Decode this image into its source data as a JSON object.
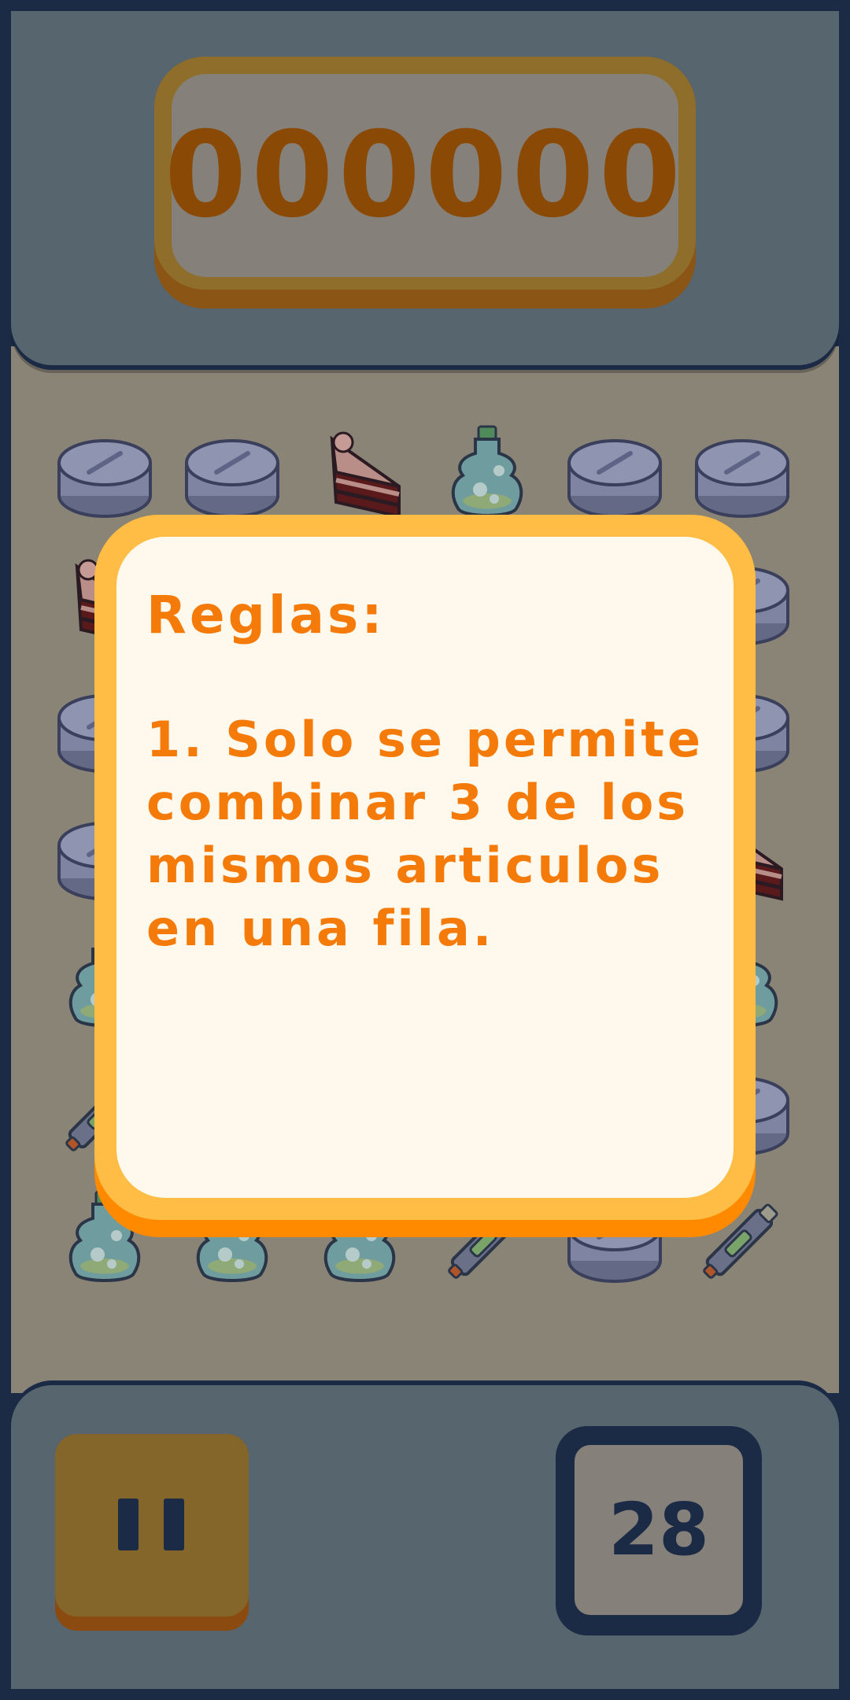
{
  "score": {
    "value": "000000"
  },
  "moves": {
    "value": "28"
  },
  "rules_modal": {
    "title": "Reglas:",
    "rule": "1. Solo se permite combinar 3 de los mismos articulos en una fila."
  },
  "board": {
    "rows": [
      [
        "tablet-icon",
        "tablet-icon",
        "cake-slice-icon",
        "potion-bottle-icon",
        "tablet-icon",
        "tablet-icon"
      ],
      [
        "cake-slice-icon",
        "",
        "",
        "",
        "",
        "tablet-icon"
      ],
      [
        "tablet-icon",
        "",
        "",
        "",
        "",
        "tablet-icon"
      ],
      [
        "tablet-icon",
        "",
        "",
        "",
        "",
        "cake-slice-icon"
      ],
      [
        "potion-bottle-icon",
        "",
        "",
        "",
        "",
        "potion-bottle-icon"
      ],
      [
        "injector-pen-icon",
        "",
        "",
        "",
        "",
        "tablet-icon"
      ],
      [
        "potion-bottle-icon",
        "potion-bottle-icon",
        "potion-bottle-icon",
        "injector-pen-icon",
        "tablet-icon",
        "injector-pen-icon"
      ]
    ]
  },
  "colors": {
    "frame": "#1b2a45",
    "bar": "#56656e",
    "board": "#8a8477",
    "modal_border": "#ffbd45",
    "modal_bg": "#fff8ec",
    "text_accent": "#f47b0a"
  }
}
